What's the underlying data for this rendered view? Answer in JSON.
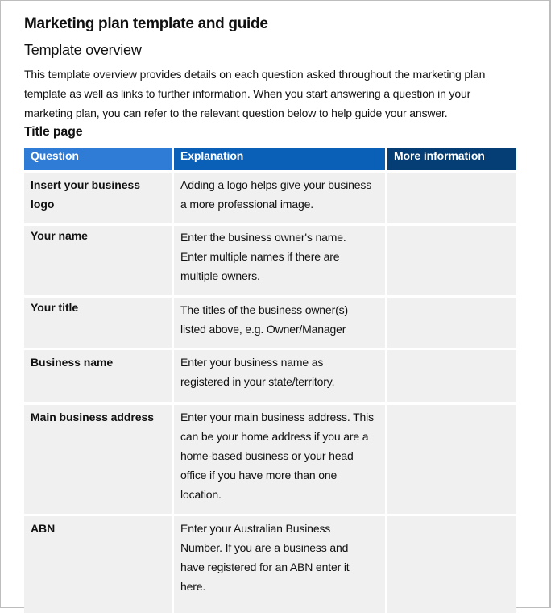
{
  "document": {
    "title": "Marketing plan template and guide",
    "subtitle": "Template overview",
    "intro_lines": [
      "This template overview provides details on each question asked throughout the marketing plan",
      "template as well as links to further information. When you start answering a question in your",
      "marketing plan,  you can  refer to the relevant question below to help guide your answer."
    ],
    "section_heading": "Title page"
  },
  "table": {
    "headers": [
      "Question",
      "Explanation",
      "More information"
    ],
    "header_colors": [
      "#2e7cd6",
      "#0a60b6",
      "#053e74"
    ],
    "cell_background": "#f0f0f0",
    "rows": [
      {
        "question_lines": [
          "Insert your business",
          "logo"
        ],
        "explanation_lines": [
          "Adding a logo helps give your business",
          "a more professional image."
        ],
        "more_information": ""
      },
      {
        "question_lines": [
          "Your name"
        ],
        "explanation_lines": [
          "Enter the business owner's name.",
          "Enter multiple names if there are",
          "multiple owners."
        ],
        "more_information": ""
      },
      {
        "question_lines": [
          "Your title"
        ],
        "explanation_lines": [
          "The titles of the business owner(s)",
          "listed above,  e.g. Owner/Manager"
        ],
        "more_information": ""
      },
      {
        "question_lines": [
          "Business name"
        ],
        "explanation_lines": [
          "Enter your business name  as",
          "registered in your state/territory."
        ],
        "more_information": ""
      },
      {
        "question_lines": [
          "Main business address"
        ],
        "explanation_lines": [
          "Enter your main  business address.  This",
          "can be your home address if you are a",
          "home-based business or your head",
          "office if you have more than one",
          "location."
        ],
        "more_information": ""
      },
      {
        "question_lines": [
          "ABN"
        ],
        "explanation_lines": [
          "Enter your Australian  Business",
          "Number. If you are a  business and",
          "have registered for an ABN  enter it",
          "here."
        ],
        "more_information": ""
      }
    ]
  }
}
